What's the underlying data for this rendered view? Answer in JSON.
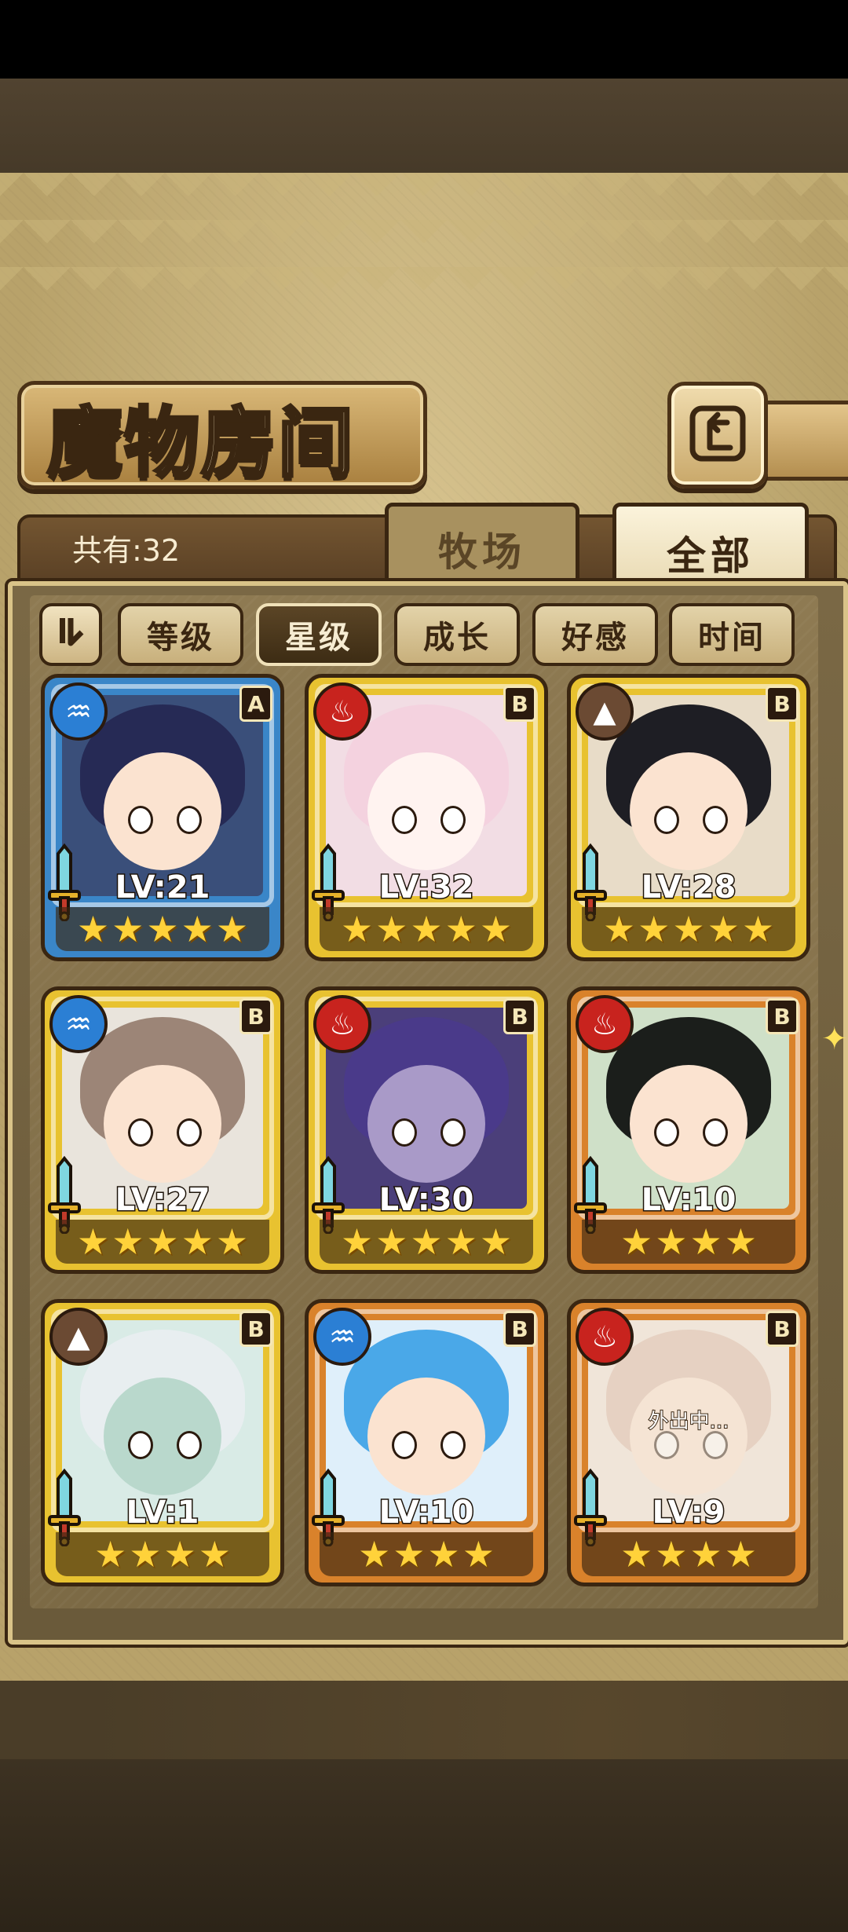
{
  "header": {
    "title": "魔物房间"
  },
  "summary": {
    "count_label": "共有:32"
  },
  "tabs": [
    {
      "label": "牧场"
    },
    {
      "label": "全部",
      "active": true
    }
  ],
  "sort": {
    "toggle_icon": "sort-toggle-icon",
    "buttons": [
      {
        "label": "等级"
      },
      {
        "label": "星级",
        "active": true
      },
      {
        "label": "成长"
      },
      {
        "label": "好感"
      },
      {
        "label": "时间"
      }
    ]
  },
  "monsters": [
    {
      "element": "water",
      "rank": "A",
      "level": "LV:21",
      "stars": 5,
      "frame": "blue"
    },
    {
      "element": "fire",
      "rank": "B",
      "level": "LV:32",
      "stars": 5,
      "frame": "gold"
    },
    {
      "element": "earth",
      "rank": "B",
      "level": "LV:28",
      "stars": 5,
      "frame": "gold"
    },
    {
      "element": "water",
      "rank": "B",
      "level": "LV:27",
      "stars": 5,
      "frame": "gold"
    },
    {
      "element": "fire",
      "rank": "B",
      "level": "LV:30",
      "stars": 5,
      "frame": "gold"
    },
    {
      "element": "fire",
      "rank": "B",
      "level": "LV:10",
      "stars": 4,
      "frame": "orange"
    },
    {
      "element": "earth",
      "rank": "B",
      "level": "LV:1",
      "stars": 4,
      "frame": "gold"
    },
    {
      "element": "water",
      "rank": "B",
      "level": "LV:10",
      "stars": 4,
      "frame": "orange"
    },
    {
      "element": "fire",
      "rank": "B",
      "level": "LV:9",
      "stars": 4,
      "frame": "orange",
      "status": "外出中..."
    }
  ],
  "colors": {
    "frame_blue": "#3a86c8",
    "frame_gold": "#e8c230",
    "frame_orange": "#d9822b",
    "element_water": "#2b7fd4",
    "element_fire": "#c8231e",
    "element_earth": "#6b4a33"
  }
}
